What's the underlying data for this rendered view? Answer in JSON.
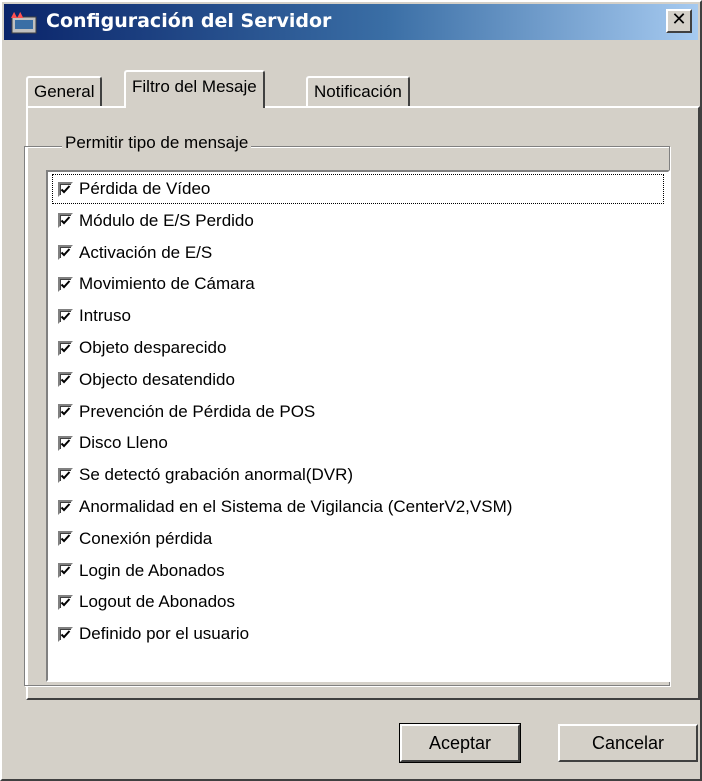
{
  "window": {
    "title": "Configuración del Servidor",
    "close_label": "✕"
  },
  "tabs": [
    {
      "label": "General",
      "active": false
    },
    {
      "label": "Filtro del Mesaje",
      "active": true
    },
    {
      "label": "Notificación",
      "active": false
    }
  ],
  "groupbox": {
    "label": "Permitir tipo de mensaje"
  },
  "message_types": [
    {
      "label": "Pérdida de Vídeo",
      "checked": true
    },
    {
      "label": "Módulo de E/S Perdido",
      "checked": true
    },
    {
      "label": "Activación de E/S",
      "checked": true
    },
    {
      "label": "Movimiento de Cámara",
      "checked": true
    },
    {
      "label": "Intruso",
      "checked": true
    },
    {
      "label": "Objeto desparecido",
      "checked": true
    },
    {
      "label": "Objecto desatendido",
      "checked": true
    },
    {
      "label": "Prevención de Pérdida de POS",
      "checked": true
    },
    {
      "label": "Disco Lleno",
      "checked": true
    },
    {
      "label": "Se detectó grabación anormal(DVR)",
      "checked": true
    },
    {
      "label": "Anormalidad en el Sistema de Vigilancia (CenterV2,VSM)",
      "checked": true
    },
    {
      "label": "Conexión pérdida",
      "checked": true
    },
    {
      "label": "Login de Abonados",
      "checked": true
    },
    {
      "label": "Logout de Abonados",
      "checked": true
    },
    {
      "label": "Definido por el usuario",
      "checked": true
    }
  ],
  "buttons": {
    "ok": "Aceptar",
    "cancel": "Cancelar"
  }
}
